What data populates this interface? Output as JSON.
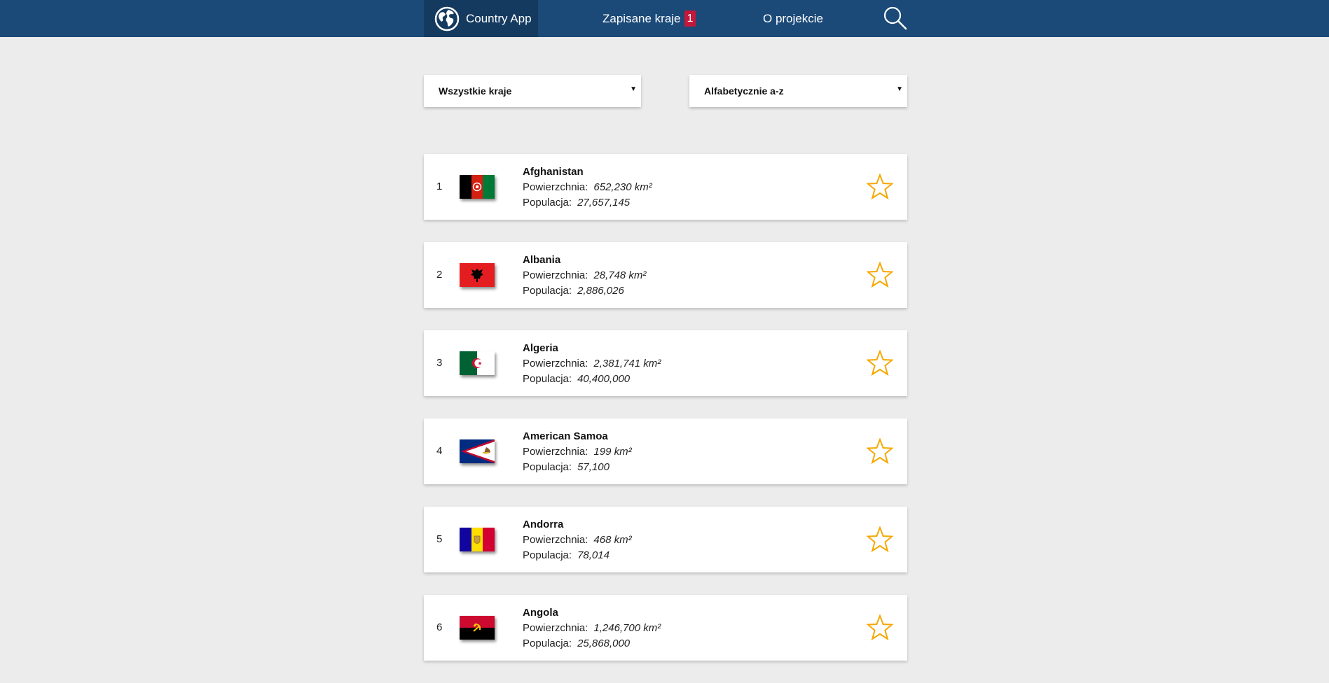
{
  "header": {
    "brand": "Country App",
    "saved_label": "Zapisane kraje",
    "saved_count": "1",
    "about_label": "O projekcie"
  },
  "filters": {
    "region": "Wszystkie kraje",
    "sort": "Alfabetycznie a-z"
  },
  "labels": {
    "area": "Powierzchnia:",
    "population": "Populacja:"
  },
  "countries": [
    {
      "index": "1",
      "name": "Afghanistan",
      "area": "652,230 km²",
      "population": "27,657,145"
    },
    {
      "index": "2",
      "name": "Albania",
      "area": "28,748 km²",
      "population": "2,886,026"
    },
    {
      "index": "3",
      "name": "Algeria",
      "area": "2,381,741 km²",
      "population": "40,400,000"
    },
    {
      "index": "4",
      "name": "American Samoa",
      "area": "199 km²",
      "population": "57,100"
    },
    {
      "index": "5",
      "name": "Andorra",
      "area": "468 km²",
      "population": "78,014"
    },
    {
      "index": "6",
      "name": "Angola",
      "area": "1,246,700 km²",
      "population": "25,868,000"
    }
  ],
  "colors": {
    "header_bg": "#1b4a78",
    "brand_bg": "#143a60",
    "badge": "#c4173a",
    "star": "#f5a800",
    "page_bg": "#ececec"
  }
}
